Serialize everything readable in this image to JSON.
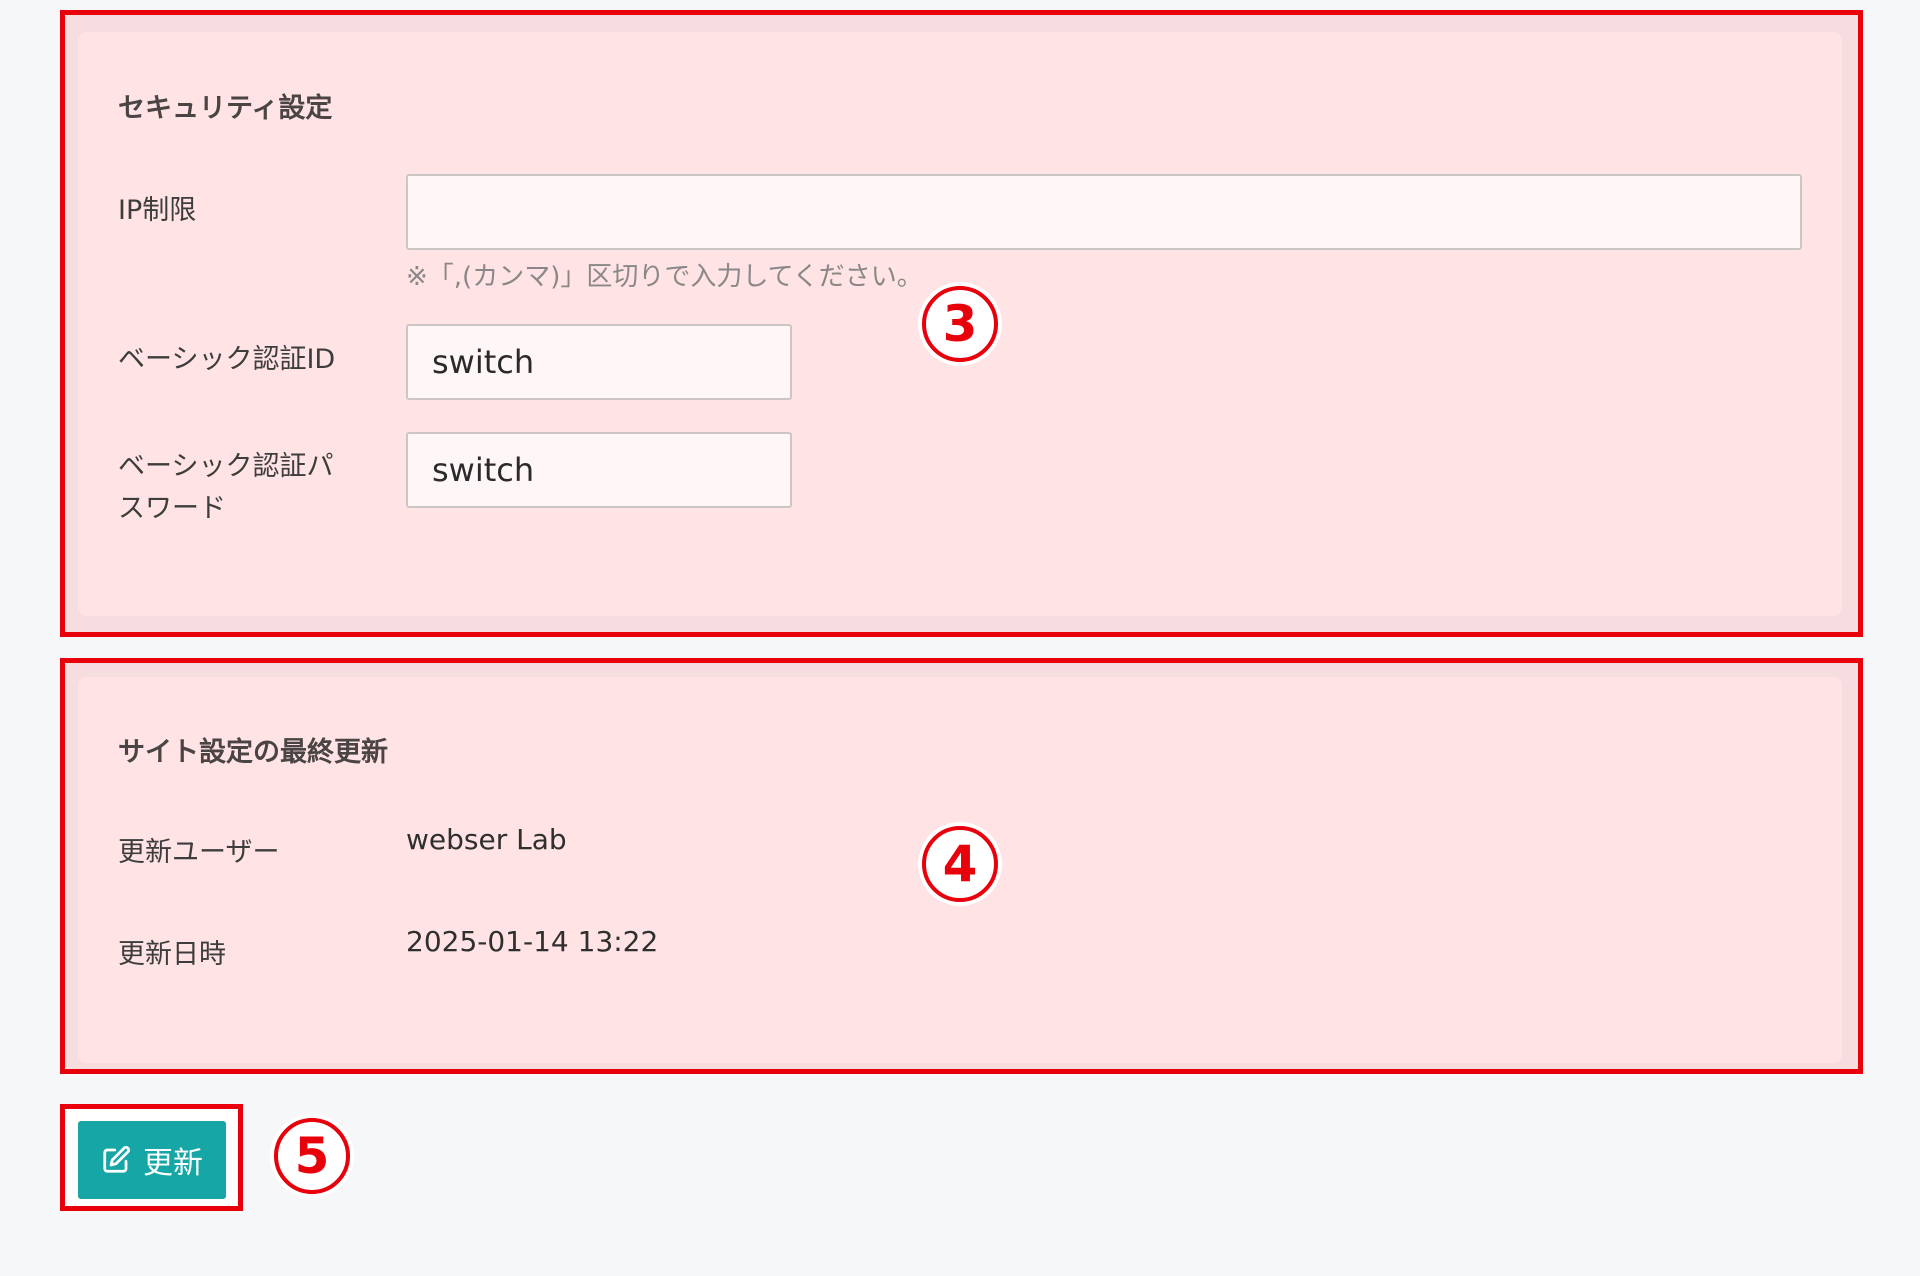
{
  "security": {
    "title": "セキュリティ設定",
    "ip_label": "IP制限",
    "ip_value": "",
    "ip_hint": "※「,(カンマ)」区切りで入力してください。",
    "basic_id_label": "ベーシック認証ID",
    "basic_id_value": "switch",
    "basic_pw_label_line1": "ベーシック認証パ",
    "basic_pw_label_line2": "スワード",
    "basic_pw_value": "switch",
    "badge": "3"
  },
  "last_update": {
    "title": "サイト設定の最終更新",
    "user_label": "更新ユーザー",
    "user_value": "webser Lab",
    "date_label": "更新日時",
    "date_value": "2025-01-14 13:22",
    "badge": "4"
  },
  "action": {
    "update_label": "更新",
    "icon": "edit-icon",
    "badge": "5"
  },
  "colors": {
    "highlight": "#e8000b",
    "card": "#ffe3e5",
    "button": "#17a6a6"
  }
}
